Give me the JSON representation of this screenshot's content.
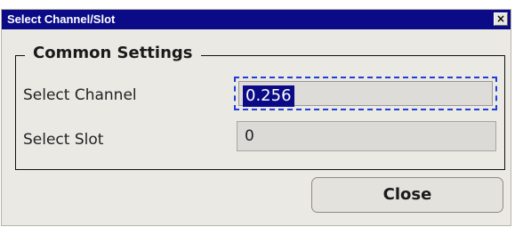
{
  "window": {
    "title": "Select Channel/Slot",
    "close_glyph": "×"
  },
  "group": {
    "legend": "Common Settings"
  },
  "fields": {
    "channel_label": "Select Channel",
    "channel_value": "0.256",
    "slot_label": "Select Slot",
    "slot_value": "0"
  },
  "buttons": {
    "close_label": "Close"
  },
  "colors": {
    "titlebar": "#0b0b88",
    "dialog_bg": "#ebe9e4",
    "focus_border": "#1f3fd6",
    "selection_bg": "#0b0b88"
  },
  "icons": {
    "titlebar_close": "close-icon"
  }
}
